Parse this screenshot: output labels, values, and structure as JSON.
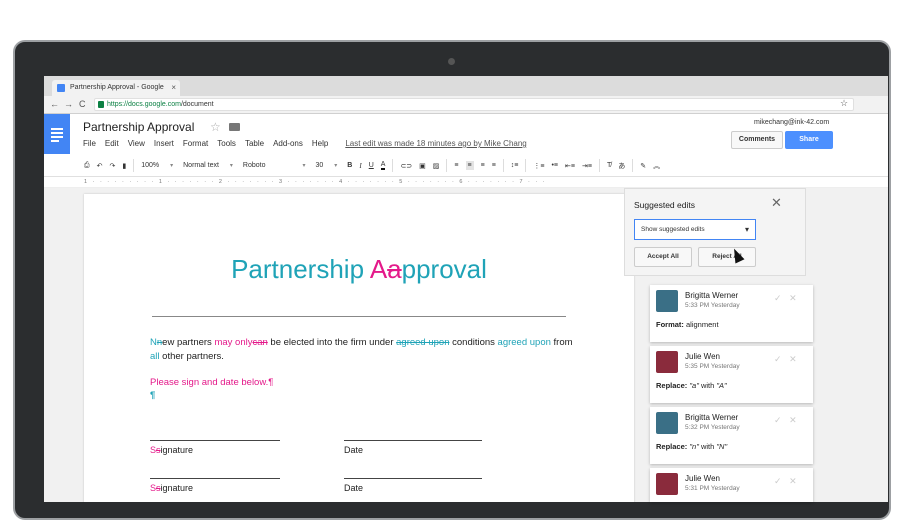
{
  "browser": {
    "tab_title": "Partnership Approval - Google",
    "tab_close": "×",
    "url_host": "https://docs.google.com",
    "url_path": "/document",
    "back": "←",
    "forward": "→",
    "reload": "C",
    "bookmark_star": "☆"
  },
  "docs": {
    "title": "Partnership Approval",
    "title_star": "☆",
    "menu": [
      "File",
      "Edit",
      "View",
      "Insert",
      "Format",
      "Tools",
      "Table",
      "Add-ons",
      "Help"
    ],
    "last_edit": "Last edit was made 18 minutes ago by Mike Chang",
    "user_email": "mikechang@ink-42.com",
    "comments_label": "Comments",
    "share_label": "Share"
  },
  "toolbar": {
    "zoom": "100%",
    "style": "Normal text",
    "font": "Roboto",
    "size": "30",
    "bold": "B",
    "italic": "I",
    "underline": "U",
    "textcolor": "A"
  },
  "ruler": {
    "text": "1 · · · · · · · · · 1 · · · · · · · 2 · · · · · · · 3 · · · · · · · 4 · · · · · · · 5 · · · · · · · 6 · · · · · · · 7 · · ·"
  },
  "document": {
    "title_prefix": "Partnership ",
    "title_ins": "A",
    "title_del": "a",
    "title_rest": "pproval",
    "para": {
      "ins1": "N",
      "del1": "n",
      "t1": "ew partners ",
      "ins2": "may only",
      "del2": "can",
      "t2": " be elected into the firm under ",
      "del3": "agreed upon",
      "t3": " conditions ",
      "ins3": "agreed upon",
      "t4": " from ",
      "ins4": "all",
      "t5": " other partners."
    },
    "please_sign": "Please sign and date below.¶",
    "pilcrow": "¶",
    "sig1_ins": "S",
    "sig1_del": "s",
    "sig1_rest": "ignature",
    "date1": "Date",
    "sig2_ins": "S",
    "sig2_del": "s",
    "sig2_rest": "ignature",
    "date2": "Date"
  },
  "suggested_panel": {
    "title": "Suggested edits",
    "close": "✕",
    "select_value": "Show suggested edits",
    "accept_all": "Accept All",
    "reject_all": "Reject All"
  },
  "cards": [
    {
      "name": "Brigitta Werner",
      "time": "5:33 PM Yesterday",
      "action": "Format:",
      "detail": " alignment",
      "from": "",
      "with": "",
      "to": "",
      "avatar_color": "#3a6f86"
    },
    {
      "name": "Julie Wen",
      "time": "5:35 PM Yesterday",
      "action": "Replace:",
      "detail": "",
      "from": "\"a\"",
      "with": " with ",
      "to": "\"A\"",
      "avatar_color": "#8a2b3c"
    },
    {
      "name": "Brigitta Werner",
      "time": "5:32 PM Yesterday",
      "action": "Replace:",
      "detail": "",
      "from": "\"n\"",
      "with": " with ",
      "to": "\"N\"",
      "avatar_color": "#3a6f86"
    },
    {
      "name": "Julie Wen",
      "time": "5:31 PM Yesterday",
      "action": "",
      "detail": "",
      "from": "",
      "with": "",
      "to": "",
      "avatar_color": "#8a2b3c"
    }
  ],
  "card_actions": {
    "accept": "✓",
    "reject": "✕"
  },
  "colors": {
    "teal": "#1fa3b7",
    "pink": "#e4198a",
    "docs_blue": "#4285f4",
    "share_blue": "#4d90fe"
  }
}
